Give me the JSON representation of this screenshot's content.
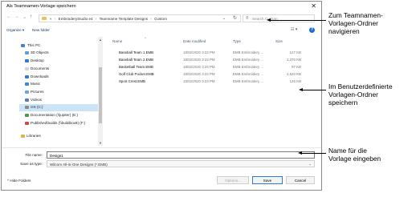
{
  "dialog": {
    "title": "Als Teamnamen-Vorlage speichern",
    "close_glyph": "✕"
  },
  "nav": {
    "back": "←",
    "forward": "→",
    "recent": "⌄",
    "up": "↑",
    "path": [
      "EmbroideryStudio e4",
      "Teamname Template Designs",
      "Custom"
    ],
    "path_separator": "›",
    "path_prefix": "«",
    "dropdown_glyph": "⌄",
    "refresh_glyph": "↻",
    "search_placeholder": "Search Custom"
  },
  "toolbar": {
    "organize": "Organize ▾",
    "new_folder": "New folder",
    "view_glyph": "☷ ▾",
    "help": "?"
  },
  "sidebar": {
    "items": [
      {
        "label": "This PC",
        "icon": "pc-icon"
      },
      {
        "label": "3D Objects",
        "icon": "3d-objects-icon"
      },
      {
        "label": "Desktop",
        "icon": "desktop-icon"
      },
      {
        "label": "Documents",
        "icon": "documents-icon"
      },
      {
        "label": "Downloads",
        "icon": "downloads-icon"
      },
      {
        "label": "Music",
        "icon": "music-icon"
      },
      {
        "label": "Pictures",
        "icon": "pictures-icon"
      },
      {
        "label": "Videos",
        "icon": "videos-icon"
      },
      {
        "label": "OS (C:)",
        "icon": "drive-icon"
      },
      {
        "label": "Documentation (\\\\jupiter) (E:)",
        "icon": "network-drive-icon"
      },
      {
        "label": "Published\\builds (\\\\buildbox9) (F:)",
        "icon": "network-drive-icon"
      },
      {
        "label": "Libraries",
        "icon": "libraries-icon"
      }
    ],
    "scroll_up": "▲",
    "scroll_down": "▼"
  },
  "files": {
    "sort_caret": "^",
    "columns": [
      "Name",
      "Date modified",
      "Type",
      "Size"
    ],
    "rows": [
      {
        "name": "Baseball Team 1.EMB",
        "date": "18/02/2020 3:23 PM",
        "type": "EMB Embroidery ...",
        "size": "127 KB"
      },
      {
        "name": "Baseball Team 2.EMB",
        "date": "18/02/2020 3:23 PM",
        "type": "EMB Embroidery ...",
        "size": "1,370 KB"
      },
      {
        "name": "Basketball Team.EMB",
        "date": "18/02/2020 3:23 PM",
        "type": "EMB Embroidery ...",
        "size": "97 KB"
      },
      {
        "name": "Golf Club Pocket.EMB",
        "date": "18/02/2020 3:23 PM",
        "type": "EMB Embroidery ...",
        "size": "1,520 KB"
      },
      {
        "name": "Sport Crest.EMB",
        "date": "18/02/2020 3:23 PM",
        "type": "EMB Embroidery ...",
        "size": "126 KB"
      }
    ]
  },
  "form": {
    "file_name_label": "File name:",
    "file_name_value": "Design1",
    "save_type_label": "Save as type:",
    "save_type_value": "Wilcom All-in-One Designs (*.EMB)",
    "save_type_chevron": "⌄",
    "hide_folders": "^ Hide Folders",
    "options_button": "Options...",
    "save_button": "Save",
    "cancel_button": "Cancel"
  },
  "callouts": {
    "navigate": [
      "Zum Teamnamen-",
      "Vorlagen-Ordner",
      "navigieren"
    ],
    "save_custom": [
      "Im Benutzerdefinierte",
      "Vorlagen-Ordner",
      "speichern"
    ],
    "enter_name": [
      "Name für die",
      "Vorlage eingeben"
    ]
  },
  "colors": {
    "accent": "#1a6fd6",
    "folder": "#e8c25a"
  }
}
